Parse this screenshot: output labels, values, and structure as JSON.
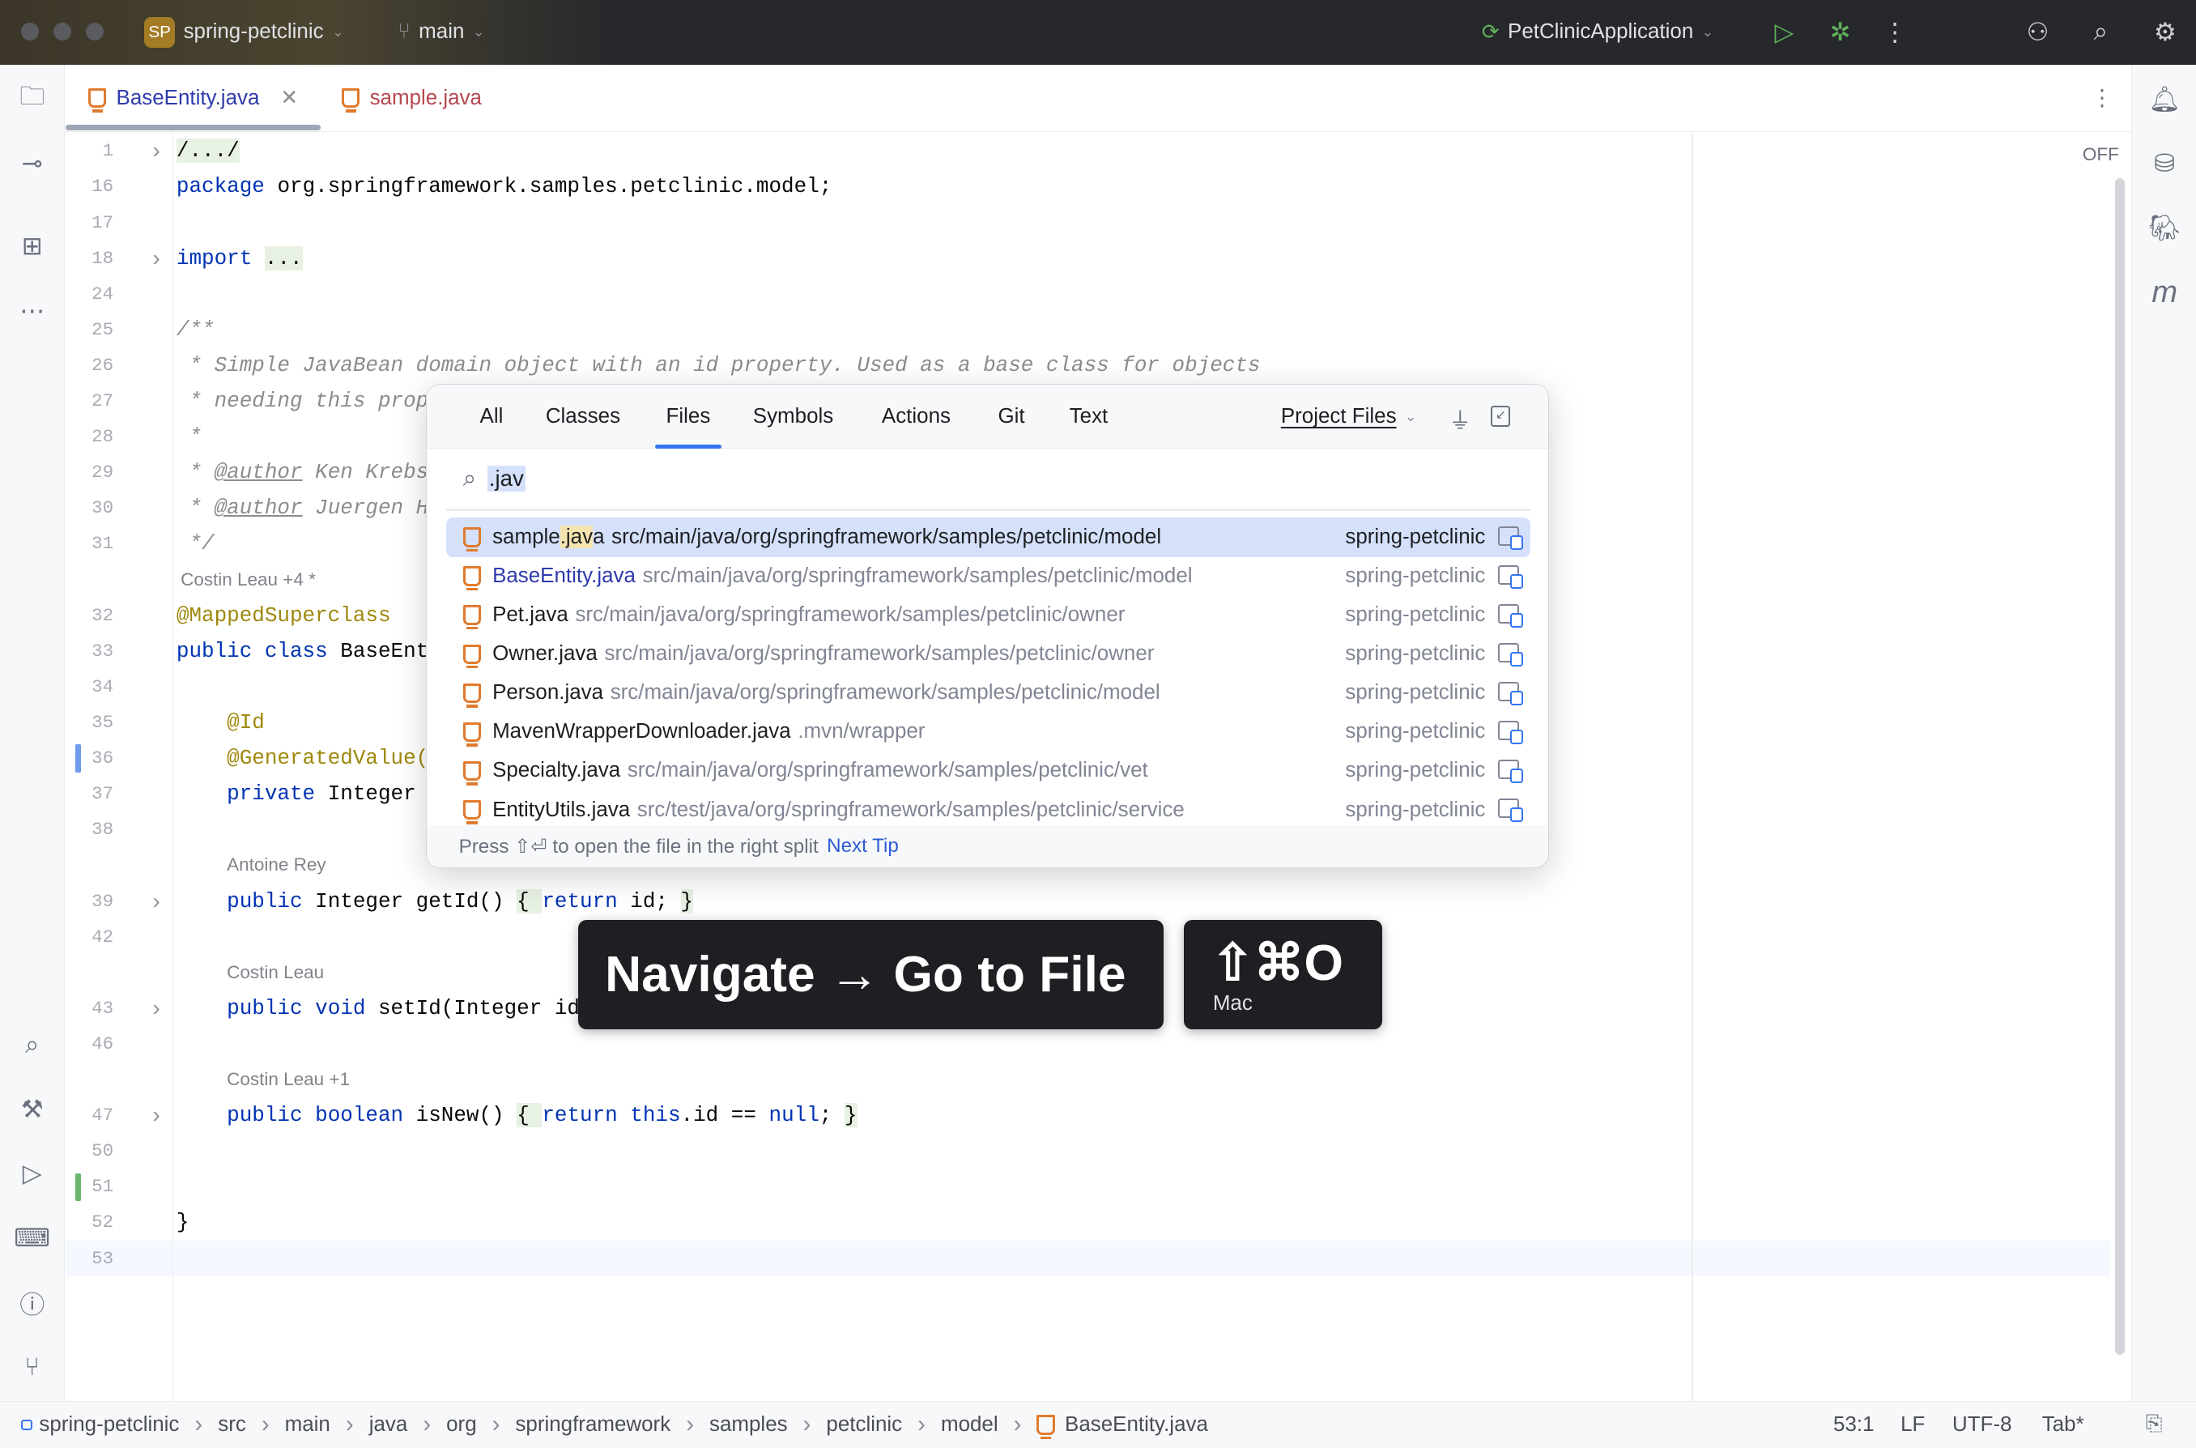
{
  "titlebar": {
    "project_badge": "SP",
    "project": "spring-petclinic",
    "branch": "main",
    "run_config": "PetClinicApplication"
  },
  "tabs": [
    {
      "label": "BaseEntity.java",
      "active": true
    },
    {
      "label": "sample.java",
      "active": false
    }
  ],
  "editor": {
    "reader_mode": "OFF",
    "rows": [
      {
        "n": "1",
        "fold": true,
        "segs": [
          {
            "t": "/.../",
            "c": "fd"
          }
        ]
      },
      {
        "n": "16",
        "segs": [
          {
            "t": "package",
            "c": "kw"
          },
          {
            "t": " org.springframework.samples.petclinic.model;"
          }
        ]
      },
      {
        "n": "17",
        "segs": []
      },
      {
        "n": "18",
        "fold": true,
        "segs": [
          {
            "t": "import",
            "c": "kw"
          },
          {
            "t": " "
          },
          {
            "t": "...",
            "c": "fd"
          }
        ]
      },
      {
        "n": "24",
        "segs": []
      },
      {
        "n": "25",
        "segs": [
          {
            "t": "/**",
            "c": "cm"
          }
        ]
      },
      {
        "n": "26",
        "segs": [
          {
            "t": " * Simple JavaBean domain object with an id property. Used as a base class for objects",
            "c": "cm"
          }
        ]
      },
      {
        "n": "27",
        "segs": [
          {
            "t": " * needing this prop",
            "c": "cm"
          }
        ]
      },
      {
        "n": "28",
        "segs": [
          {
            "t": " *",
            "c": "cm"
          }
        ]
      },
      {
        "n": "29",
        "segs": [
          {
            "t": " * ",
            "c": "cm"
          },
          {
            "t": "@author",
            "c": "tag"
          },
          {
            "t": " Ken Krebs",
            "c": "cm"
          }
        ]
      },
      {
        "n": "30",
        "segs": [
          {
            "t": " * ",
            "c": "cm"
          },
          {
            "t": "@author",
            "c": "tag"
          },
          {
            "t": " Juergen H",
            "c": "cm"
          }
        ]
      },
      {
        "n": "31",
        "segs": [
          {
            "t": " */",
            "c": "cm"
          }
        ]
      },
      {
        "inlay": "Costin Leau +4 *",
        "indent": 0
      },
      {
        "n": "32",
        "segs": [
          {
            "t": "@MappedSuperclass",
            "c": "an"
          }
        ]
      },
      {
        "n": "33",
        "segs": [
          {
            "t": "public class",
            "c": "kw"
          },
          {
            "t": " BaseEnt"
          }
        ]
      },
      {
        "n": "34",
        "segs": []
      },
      {
        "n": "35",
        "segs": [
          {
            "t": "    "
          },
          {
            "t": "@Id",
            "c": "an"
          }
        ]
      },
      {
        "n": "36",
        "mark": "blue",
        "segs": [
          {
            "t": "    "
          },
          {
            "t": "@GeneratedValue(",
            "c": "an"
          }
        ]
      },
      {
        "n": "37",
        "segs": [
          {
            "t": "    "
          },
          {
            "t": "private",
            "c": "kw"
          },
          {
            "t": " Integer"
          }
        ]
      },
      {
        "n": "38",
        "segs": []
      },
      {
        "inlay": "Antoine Rey",
        "indent": 1
      },
      {
        "n": "39",
        "fold": true,
        "segs": [
          {
            "t": "    "
          },
          {
            "t": "public",
            "c": "kw"
          },
          {
            "t": " Integer getId() "
          },
          {
            "t": "{ ",
            "c": "fd"
          },
          {
            "t": "return",
            "c": "kw"
          },
          {
            "t": " id; "
          },
          {
            "t": "}",
            "c": "fd"
          }
        ]
      },
      {
        "n": "42",
        "segs": []
      },
      {
        "inlay": "Costin Leau",
        "indent": 1
      },
      {
        "n": "43",
        "fold": true,
        "segs": [
          {
            "t": "    "
          },
          {
            "t": "public void",
            "c": "kw"
          },
          {
            "t": " setId(Integer id"
          }
        ]
      },
      {
        "n": "46",
        "segs": []
      },
      {
        "inlay": "Costin Leau +1",
        "indent": 1
      },
      {
        "n": "47",
        "fold": true,
        "segs": [
          {
            "t": "    "
          },
          {
            "t": "public boolean",
            "c": "kw"
          },
          {
            "t": " isNew() "
          },
          {
            "t": "{ ",
            "c": "fd"
          },
          {
            "t": "return this",
            "c": "kw"
          },
          {
            "t": ".id == "
          },
          {
            "t": "null",
            "c": "kw"
          },
          {
            "t": "; "
          },
          {
            "t": "}",
            "c": "fd"
          }
        ]
      },
      {
        "n": "50",
        "segs": []
      },
      {
        "n": "51",
        "mark": "green",
        "segs": []
      },
      {
        "n": "52",
        "segs": [
          {
            "t": "}"
          }
        ]
      },
      {
        "n": "53",
        "current": true,
        "segs": []
      }
    ]
  },
  "popup": {
    "tabs": [
      "All",
      "Classes",
      "Files",
      "Symbols",
      "Actions",
      "Git",
      "Text"
    ],
    "active_tab": "Files",
    "scope": "Project Files",
    "query": ".jav",
    "results": [
      {
        "name_pre": "sample",
        "name_match": ".jav",
        "name_post": "a",
        "path": "src/main/java/org/springframework/samples/petclinic/model",
        "module": "spring-petclinic",
        "selected": true
      },
      {
        "name": "BaseEntity.java",
        "path": "src/main/java/org/springframework/samples/petclinic/model",
        "module": "spring-petclinic",
        "blue": true
      },
      {
        "name": "Pet.java",
        "path": "src/main/java/org/springframework/samples/petclinic/owner",
        "module": "spring-petclinic"
      },
      {
        "name": "Owner.java",
        "path": "src/main/java/org/springframework/samples/petclinic/owner",
        "module": "spring-petclinic"
      },
      {
        "name": "Person.java",
        "path": "src/main/java/org/springframework/samples/petclinic/model",
        "module": "spring-petclinic"
      },
      {
        "name": "MavenWrapperDownloader.java",
        "path": ".mvn/wrapper",
        "module": "spring-petclinic"
      },
      {
        "name": "Specialty.java",
        "path": "src/main/java/org/springframework/samples/petclinic/vet",
        "module": "spring-petclinic"
      },
      {
        "name": "EntityUtils.java",
        "path": "src/test/java/org/springframework/samples/petclinic/service",
        "module": "spring-petclinic"
      }
    ],
    "footer_text": "Press ⇧⏎ to open the file in the right split",
    "footer_link": "Next Tip"
  },
  "hint": {
    "action": "Navigate → Go to File",
    "shortcut": "⇧⌘O",
    "os": "Mac"
  },
  "statusbar": {
    "breadcrumbs": [
      "spring-petclinic",
      "src",
      "main",
      "java",
      "org",
      "springframework",
      "samples",
      "petclinic",
      "model",
      "BaseEntity.java"
    ],
    "position": "53:1",
    "line_sep": "LF",
    "encoding": "UTF-8",
    "indent": "Tab*"
  }
}
